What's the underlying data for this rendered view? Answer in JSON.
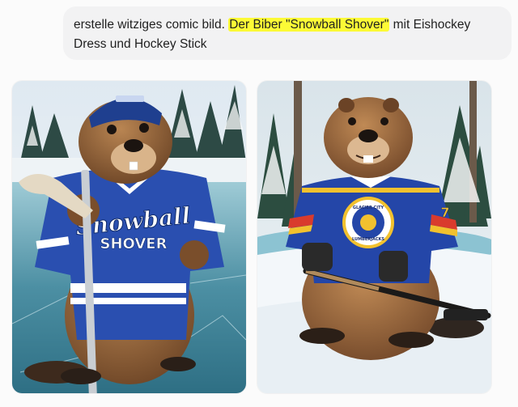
{
  "prompt": {
    "text_before": "erstelle witziges comic bild. ",
    "text_highlight": "Der Biber \"Snowball Shover\"",
    "text_after": " mit Eishockey Dress und Hockey Stick"
  },
  "images": [
    {
      "jersey_text_line1": "Snowball",
      "jersey_text_line2": "SHOVER",
      "jersey_color": "#2a4fb0"
    },
    {
      "crest_text_top": "GLACIER CITY",
      "crest_text_bottom": "LUMBERJACKS",
      "number": "7",
      "jersey_color": "#2446a8"
    }
  ],
  "colors": {
    "highlight": "#fcfa36",
    "bubble_bg": "#f2f2f3"
  }
}
